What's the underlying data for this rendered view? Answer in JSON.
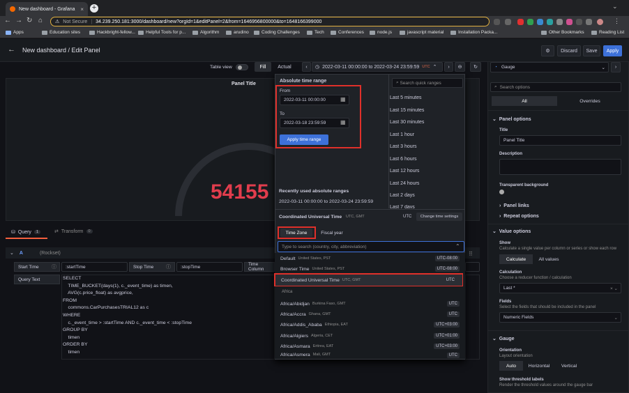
{
  "browser": {
    "tab_title": "New dashboard - Grafana",
    "not_secure": "Not Secure",
    "url": "34.239.250.181:3000/dashboard/new?orgId=1&editPanel=2&from=1646956800000&to=1648166399000",
    "bookmarks": [
      "Apps",
      "Education sites",
      "Hackbright-fellow...",
      "Helpful Tools for p...",
      "Algorithm",
      "arudino",
      "Coding Challenges",
      "Tech",
      "Conferences",
      "node.js",
      "javascript material",
      "Installation Packa..."
    ],
    "bookmarks_right": [
      "Other Bookmarks",
      "Reading List"
    ]
  },
  "header": {
    "title": "New dashboard / Edit Panel",
    "discard": "Discard",
    "save": "Save",
    "apply": "Apply"
  },
  "toolbar": {
    "table_view": "Table view",
    "fill": "Fill",
    "actual": "Actual",
    "range": "2022-03-11 00:00:00 to 2022-03-24 23:59:59",
    "utc": "UTC"
  },
  "panel": {
    "title": "Panel Title",
    "value": "54155"
  },
  "picker": {
    "abs_title": "Absolute time range",
    "from_label": "From",
    "from_value": "2022-03-11 00:00:00",
    "to_label": "To",
    "to_value": "2022-03-18 23:59:59",
    "apply": "Apply time range",
    "recent_title": "Recently used absolute ranges",
    "recent_item": "2022-03-11 00:00:00 to 2022-03-24 23:59:59",
    "search_placeholder": "Search quick ranges",
    "quick": [
      "Last 5 minutes",
      "Last 15 minutes",
      "Last 30 minutes",
      "Last 1 hour",
      "Last 3 hours",
      "Last 6 hours",
      "Last 12 hours",
      "Last 24 hours",
      "Last 2 days",
      "Last 7 days"
    ],
    "tz_current": "Coordinated Universal Time",
    "tz_current_sub": "UTC, GMT",
    "tz_utc": "UTC",
    "change_tz": "Change time settings",
    "tab_tz": "Time Zone",
    "tab_fiscal": "Fiscal year",
    "tz_placeholder": "Type to search (country, city, abbreviation)",
    "tz_list": [
      {
        "name": "Default",
        "sub": "United States, PST",
        "off": "UTC-08:00"
      },
      {
        "name": "Browser Time",
        "sub": "United States, PST",
        "off": "UTC-08:00"
      },
      {
        "name": "Coordinated Universal Time",
        "sub": "UTC, GMT",
        "off": "UTC"
      }
    ],
    "africa_label": "Africa",
    "africa": [
      {
        "name": "Africa/Abidjan",
        "sub": "Burkina Faso, GMT",
        "off": "UTC"
      },
      {
        "name": "Africa/Accra",
        "sub": "Ghana, GMT",
        "off": "UTC"
      },
      {
        "name": "Africa/Addis_Ababa",
        "sub": "Ethiopia, EAT",
        "off": "UTC+03:00"
      },
      {
        "name": "Africa/Algiers",
        "sub": "Algeria, CET",
        "off": "UTC+01:00"
      },
      {
        "name": "Africa/Asmara",
        "sub": "Eritrea, EAT",
        "off": "UTC+03:00"
      },
      {
        "name": "Africa/Asmera",
        "sub": "Mali, GMT",
        "off": "UTC"
      }
    ]
  },
  "query": {
    "tab_query": "Query",
    "query_count": "1",
    "tab_transform": "Transform",
    "transform_count": "0",
    "ref": "A",
    "ds": "(Rockset)",
    "start_time_label": "Start Time",
    "start_time_value": ":startTime",
    "stop_time_label": "Stop Time",
    "stop_time_value": ":stopTime",
    "time_column_label": "Time Column",
    "query_text_label": "Query Text",
    "code": "SELECT\n    TIME_BUCKET(days(1), c._event_time) as timen,\n    AVG(c.price_float) as avgprice,\nFROM\n    commons.CarPurchasesTRIAL12 as c\nWHERE\n    c._event_time > :startTime AND c._event_time < :stopTime\nGROUP BY\n    timen\nORDER BY\n    timen"
  },
  "options": {
    "viz": "Gauge",
    "search": "Search options",
    "tab_all": "All",
    "tab_overrides": "Overrides",
    "panel_options": "Panel options",
    "title_label": "Title",
    "title_value": "Panel Title",
    "desc_label": "Description",
    "transparent": "Transparent background",
    "panel_links": "Panel links",
    "repeat": "Repeat options",
    "value_options": "Value options",
    "show_label": "Show",
    "show_desc": "Calculate a single value per column or series or show each row",
    "calc": "Calculate",
    "allvals": "All values",
    "calc_label": "Calculation",
    "calc_desc": "Choose a reducer function / calculation",
    "calc_value": "Last *",
    "fields_label": "Fields",
    "fields_desc": "Select the fields that should be included in the panel",
    "fields_value": "Numeric Fields",
    "gauge": "Gauge",
    "orient_label": "Orientation",
    "orient_desc": "Layout orientation",
    "auto": "Auto",
    "horizontal": "Horizontal",
    "vertical": "Vertical",
    "thresh_label": "Show threshold labels",
    "thresh_desc": "Render the threshold values around the gauge bar"
  }
}
